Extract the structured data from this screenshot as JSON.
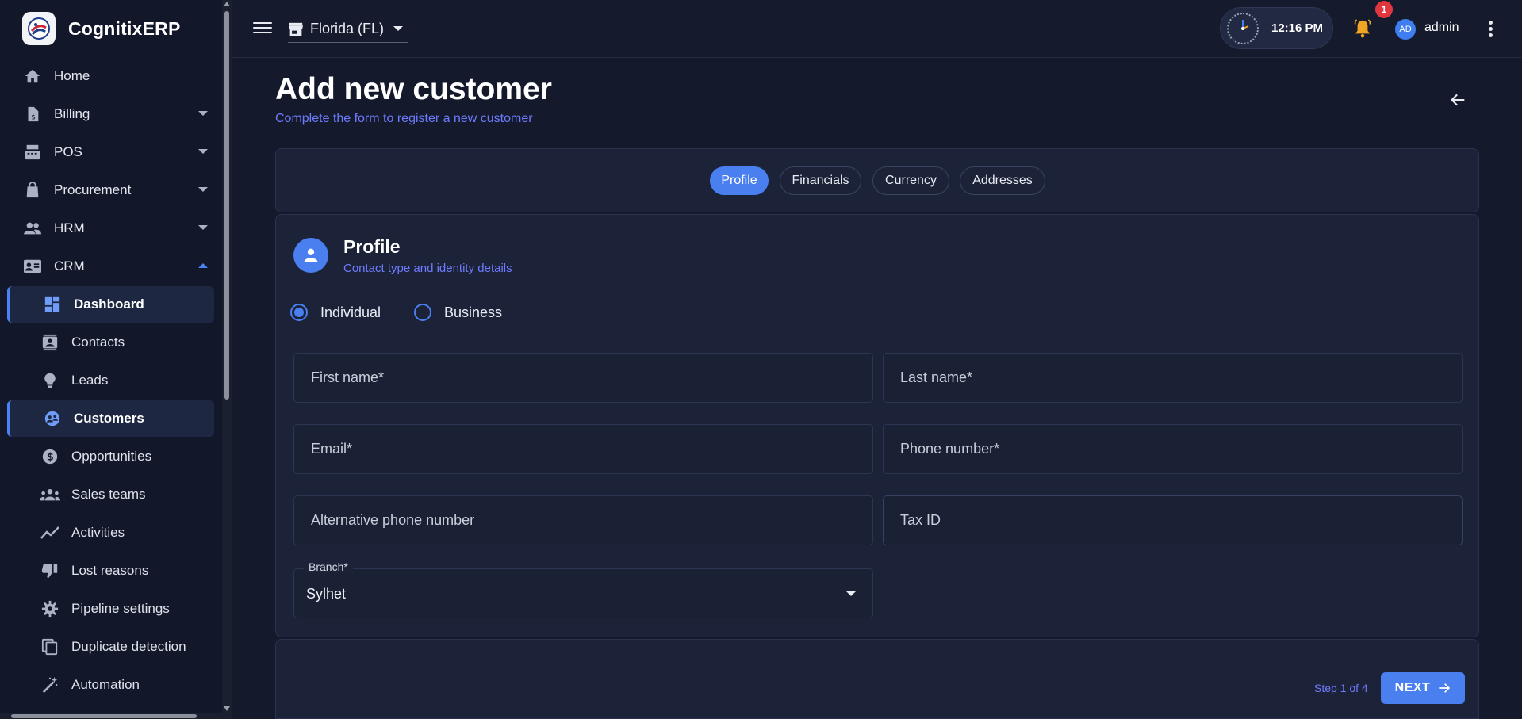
{
  "app": {
    "name": "CognitixERP"
  },
  "sidebar": {
    "items": [
      {
        "label": "Home",
        "icon": "home-icon"
      },
      {
        "label": "Billing",
        "icon": "billing-icon"
      },
      {
        "label": "POS",
        "icon": "pos-icon"
      },
      {
        "label": "Procurement",
        "icon": "procurement-icon"
      },
      {
        "label": "HRM",
        "icon": "hrm-icon"
      },
      {
        "label": "CRM",
        "icon": "crm-icon"
      }
    ],
    "crm_items": [
      {
        "label": "Dashboard",
        "icon": "dashboard-icon"
      },
      {
        "label": "Contacts",
        "icon": "contacts-icon"
      },
      {
        "label": "Leads",
        "icon": "lightbulb-icon"
      },
      {
        "label": "Customers",
        "icon": "customers-icon"
      },
      {
        "label": "Opportunities",
        "icon": "dollar-icon"
      },
      {
        "label": "Sales teams",
        "icon": "team-icon"
      },
      {
        "label": "Activities",
        "icon": "trend-icon"
      },
      {
        "label": "Lost reasons",
        "icon": "thumb-down-icon"
      },
      {
        "label": "Pipeline settings",
        "icon": "gear-icon"
      },
      {
        "label": "Duplicate detection",
        "icon": "copy-icon"
      },
      {
        "label": "Automation",
        "icon": "wand-icon"
      }
    ]
  },
  "topbar": {
    "store": "Florida (FL)",
    "time": "12:16 PM",
    "notification_count": "1",
    "avatar_initials": "AD",
    "username": "admin"
  },
  "page": {
    "title": "Add new customer",
    "subtitle": "Complete the form to register a new customer"
  },
  "tabs": [
    {
      "label": "Profile",
      "active": true
    },
    {
      "label": "Financials"
    },
    {
      "label": "Currency"
    },
    {
      "label": "Addresses"
    }
  ],
  "section": {
    "title": "Profile",
    "subtitle": "Contact type and identity details"
  },
  "contact_type": {
    "options": [
      "Individual",
      "Business"
    ],
    "selected": "Individual"
  },
  "fields": {
    "first_name": "First name*",
    "last_name": "Last name*",
    "email": "Email*",
    "phone": "Phone number*",
    "alt_phone": "Alternative phone number",
    "tax_id": "Tax ID"
  },
  "branch": {
    "label": "Branch*",
    "value": "Sylhet"
  },
  "footer": {
    "step": "Step 1 of 4",
    "next_label": "NEXT"
  },
  "colors": {
    "accent": "#4a7ff0",
    "link": "#6f7bff",
    "background": "#141a2b",
    "card": "#1c2338",
    "badge": "#e2363f",
    "bell": "#f0a623"
  }
}
